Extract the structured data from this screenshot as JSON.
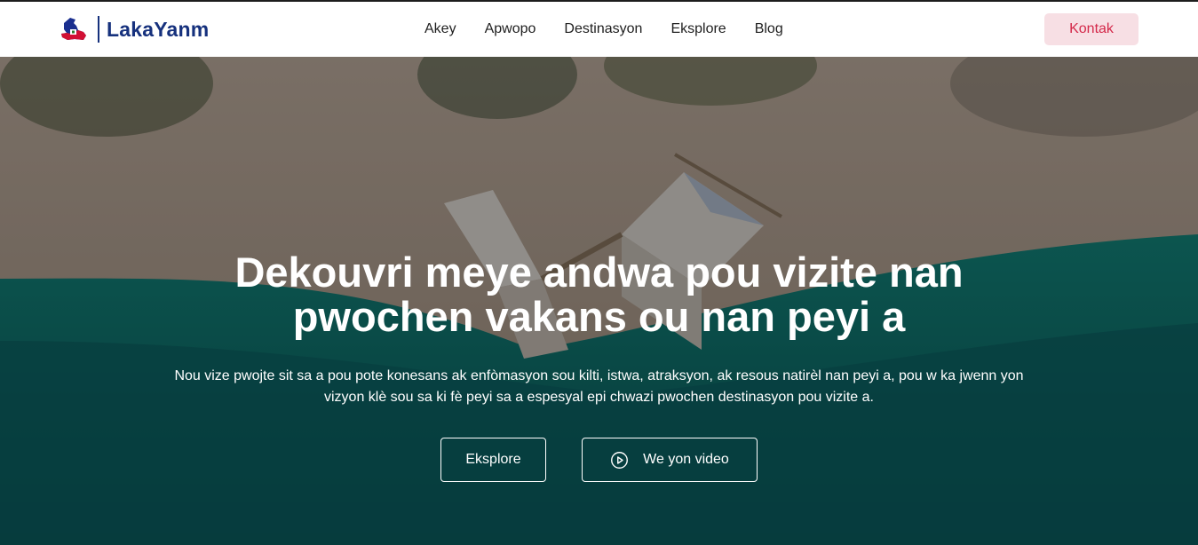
{
  "brand": {
    "name": "LakaYanm",
    "logo_icon": "haiti-map-icon"
  },
  "nav": {
    "items": [
      {
        "label": "Akey"
      },
      {
        "label": "Apwopo"
      },
      {
        "label": "Destinasyon"
      },
      {
        "label": "Eksplore"
      },
      {
        "label": "Blog"
      }
    ],
    "contact_label": "Kontak"
  },
  "hero": {
    "title": "Dekouvri meye andwa pou vizite nan pwochen vakans ou nan peyi a",
    "subtitle": "Nou vize pwojte sit sa a pou pote konesans ak enfòmasyon sou kilti, istwa, atraksyon, ak resous natirèl nan peyi a, pou w ka jwenn yon vizyon klè sou sa ki fè peyi sa a espesyal epi chwazi pwochen destinasyon pou vizite a.",
    "explore_label": "Eksplore",
    "video_label": "We yon video",
    "video_icon": "play-circle-icon"
  },
  "colors": {
    "brand_blue": "#16317d",
    "contact_bg": "#f7dfe4",
    "contact_text": "#d4294a",
    "sea": "#0e6e6a",
    "sand": "#b9a89a"
  }
}
